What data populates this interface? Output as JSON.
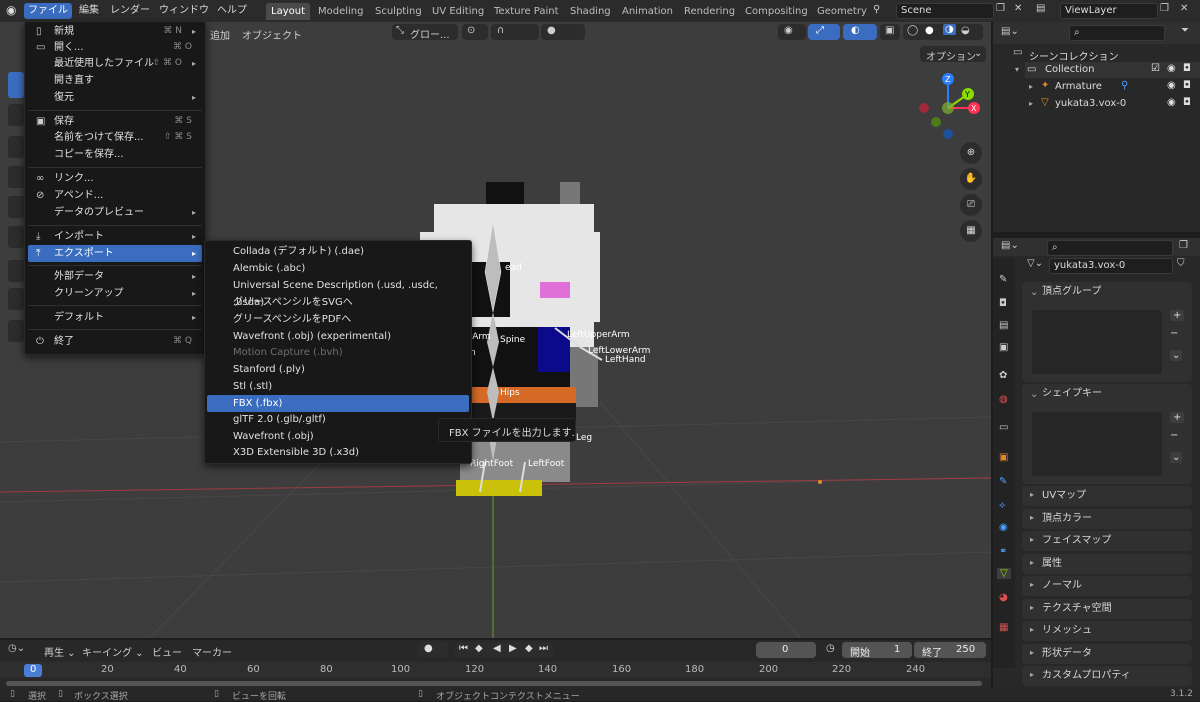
{
  "topbar": {
    "menus": [
      "ファイル",
      "編集",
      "レンダー",
      "ウィンドウ",
      "ヘルプ"
    ],
    "workspaces": [
      "Layout",
      "Modeling",
      "Sculpting",
      "UV Editing",
      "Texture Paint",
      "Shading",
      "Animation",
      "Rendering",
      "Compositing",
      "Geometry"
    ],
    "scene": "Scene",
    "view_layer": "ViewLayer"
  },
  "viewport_header": {
    "add": "追加",
    "object": "オブジェクト",
    "transform": "グロー...",
    "options": "オプション"
  },
  "file_menu": {
    "items": [
      {
        "label": "新規",
        "shortcut": "⌘ N",
        "submenu": true,
        "icon": "document-icon"
      },
      {
        "label": "開く...",
        "shortcut": "⌘ O",
        "icon": "folder-icon"
      },
      {
        "label": "最近使用したファイル",
        "shortcut": "⇧ ⌘ O",
        "submenu": true
      },
      {
        "label": "開き直す"
      },
      {
        "label": "復元",
        "submenu": true
      },
      {
        "label": "保存",
        "shortcut": "⌘ S",
        "icon": "save-icon"
      },
      {
        "label": "名前をつけて保存...",
        "shortcut": "⇧ ⌘ S"
      },
      {
        "label": "コピーを保存..."
      },
      {
        "label": "リンク...",
        "icon": "link-icon"
      },
      {
        "label": "アペンド...",
        "icon": "append-icon"
      },
      {
        "label": "データのプレビュー",
        "submenu": true
      },
      {
        "label": "インポート",
        "submenu": true,
        "icon": "import-icon"
      },
      {
        "label": "エクスポート",
        "submenu": true,
        "icon": "export-icon"
      },
      {
        "label": "外部データ",
        "submenu": true
      },
      {
        "label": "クリーンアップ",
        "submenu": true
      },
      {
        "label": "デフォルト",
        "submenu": true
      },
      {
        "label": "終了",
        "shortcut": "⌘ Q",
        "icon": "power-icon"
      }
    ]
  },
  "export_menu": {
    "items": [
      "Collada (デフォルト) (.dae)",
      "Alembic (.abc)",
      "Universal Scene Description (.usd, .usdc, .usda)",
      "グリースペンシルをSVGへ",
      "グリースペンシルをPDFへ",
      "Wavefront (.obj) (experimental)",
      "Motion Capture (.bvh)",
      "Stanford (.ply)",
      "Stl (.stl)",
      "FBX (.fbx)",
      "glTF 2.0 (.glb/.gltf)",
      "Wavefront (.obj)",
      "X3D Extensible 3D (.x3d)"
    ],
    "tooltip": "FBX ファイルを出力します."
  },
  "bones": {
    "head": "ead",
    "left_upper_arm": "LeftUpperArm",
    "right_arm": "erArm",
    "spine": "Spine",
    "left_lower_arm": "LeftLowerArm",
    "left_hand": "LeftHand",
    "hips": "Hips",
    "leg": "Leg",
    "right_foot": "RightFoot",
    "left_foot": "LeftFoot",
    "n": "n"
  },
  "outliner": {
    "root": "シーンコレクション",
    "collection": "Collection",
    "items": [
      "Armature",
      "yukata3.vox-0"
    ]
  },
  "properties": {
    "object_name": "yukata3.vox-0",
    "panels": [
      "頂点グループ",
      "シェイプキー",
      "UVマップ",
      "頂点カラー",
      "フェイスマップ",
      "属性",
      "ノーマル",
      "テクスチャ空間",
      "リメッシュ",
      "形状データ",
      "カスタムプロパティ"
    ]
  },
  "timeline": {
    "menus": [
      "再生",
      "キーイング",
      "ビュー",
      "マーカー"
    ],
    "current_frame": "0",
    "start_label": "開始",
    "start": "1",
    "end_label": "終了",
    "end": "250",
    "ruler": [
      "0",
      "20",
      "40",
      "60",
      "80",
      "100",
      "120",
      "140",
      "160",
      "180",
      "200",
      "220",
      "240"
    ]
  },
  "statusbar": {
    "select": "選択",
    "box_select": "ボックス選択",
    "rotate_view": "ビューを回転",
    "context_menu": "オブジェクトコンテクストメニュー",
    "version": "3.1.2"
  },
  "colors": {
    "accent": "#3a6dbf",
    "x_axis": "#ff3352",
    "y_axis": "#8bdc00",
    "z_axis": "#2b7fff"
  }
}
